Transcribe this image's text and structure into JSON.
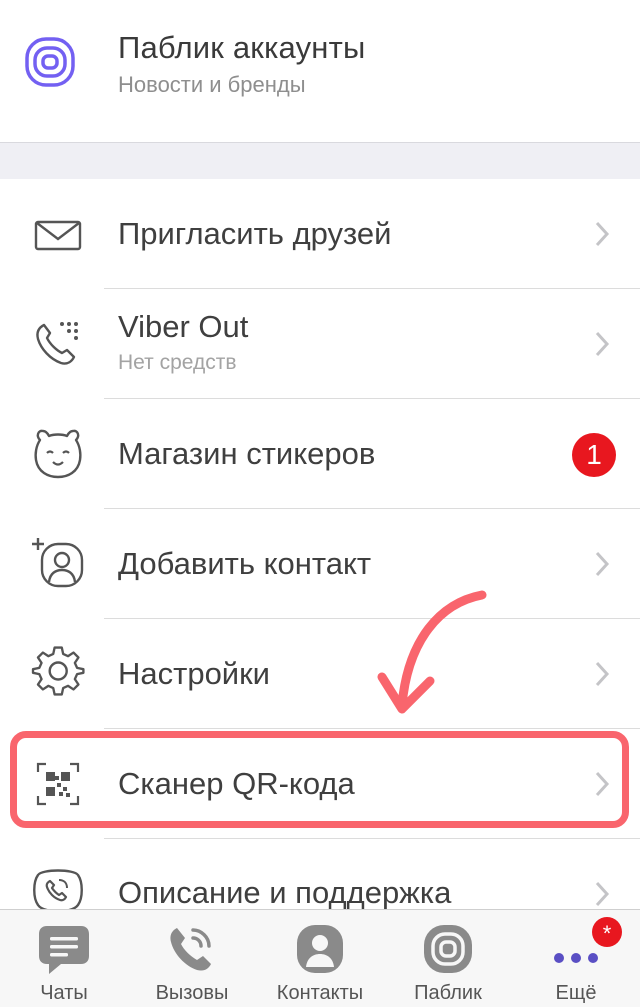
{
  "public_accounts": {
    "title": "Паблик аккаунты",
    "subtitle": "Новости и бренды",
    "icon": "public-accounts-icon"
  },
  "menu": {
    "items": [
      {
        "label": "Пригласить друзей",
        "icon": "envelope-icon"
      },
      {
        "label": "Viber Out",
        "sublabel": "Нет средств",
        "icon": "phone-keypad-icon"
      },
      {
        "label": "Магазин стикеров",
        "icon": "bear-face-icon",
        "badge": "1"
      },
      {
        "label": "Добавить контакт",
        "icon": "add-contact-icon"
      },
      {
        "label": "Настройки",
        "icon": "gear-icon"
      },
      {
        "label": "Сканер QR-кода",
        "icon": "qr-code-icon"
      },
      {
        "label": "Описание и поддержка",
        "icon": "viber-logo-icon"
      }
    ]
  },
  "tabbar": {
    "tabs": [
      {
        "label": "Чаты",
        "icon": "chat-icon"
      },
      {
        "label": "Вызовы",
        "icon": "calls-icon"
      },
      {
        "label": "Контакты",
        "icon": "contacts-icon"
      },
      {
        "label": "Паблик",
        "icon": "public-icon"
      },
      {
        "label": "Ещё",
        "icon": "more-dots-icon",
        "badge": "*"
      }
    ]
  },
  "colors": {
    "brand_purple": "#7360f2",
    "annotation_red": "#f9656d",
    "badge_red": "#e8171f",
    "tab_icon_gray": "#8a8a8a"
  }
}
